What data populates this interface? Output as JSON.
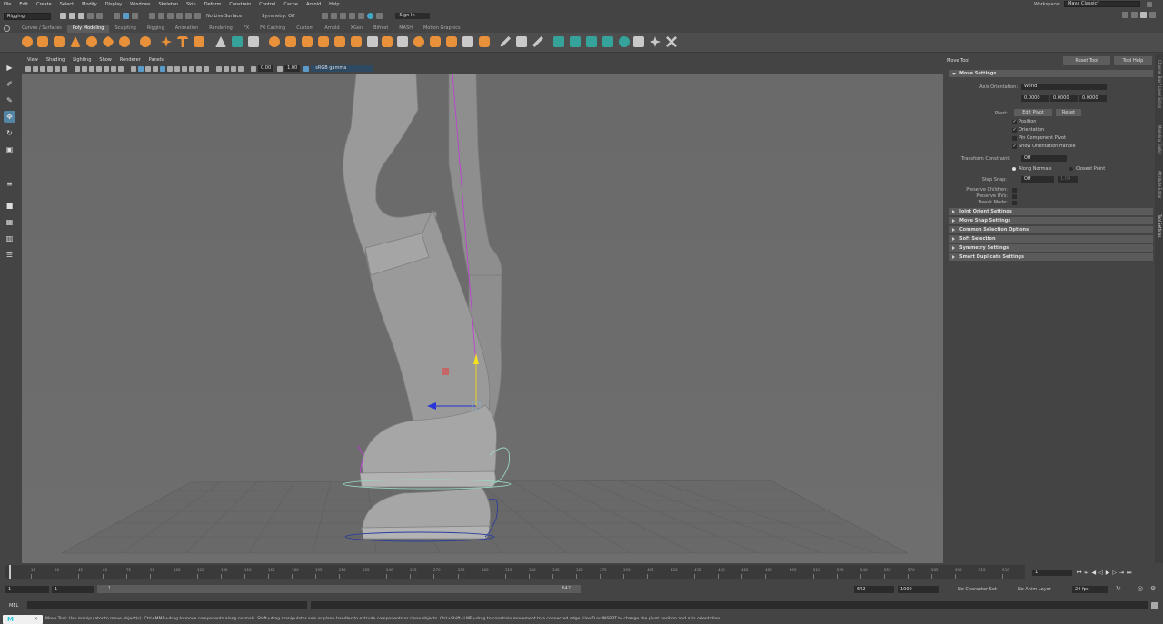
{
  "menu": [
    "File",
    "Edit",
    "Create",
    "Select",
    "Modify",
    "Display",
    "Windows",
    "Skeleton",
    "Skin",
    "Deform",
    "Constrain",
    "Control",
    "Cache",
    "Arnold",
    "Help"
  ],
  "workspace": {
    "label": "Workspace:",
    "value": "Maya Classic*"
  },
  "status": {
    "mode": "Rigging",
    "live_surface": "No Live Surface",
    "symmetry": "Symmetry: Off",
    "sign_in": "Sign In"
  },
  "shelf_tabs": [
    "Curves / Surfaces",
    "Poly Modeling",
    "Sculpting",
    "Rigging",
    "Animation",
    "Rendering",
    "FX",
    "FX Caching",
    "Custom",
    "Arnold",
    "XGen",
    "Bifrost",
    "MASH",
    "Motion Graphics"
  ],
  "active_shelf": "Poly Modeling",
  "viewport_menu": [
    "View",
    "Shading",
    "Lighting",
    "Show",
    "Renderer",
    "Panels"
  ],
  "viewport_toolbar": {
    "exposure": "0.00",
    "gamma": "1.00",
    "colorspace": "sRGB gamma"
  },
  "panel": {
    "title": "Move Tool",
    "reset_tool": "Reset Tool",
    "tool_help": "Tool Help",
    "move_settings": "Move Settings",
    "axis_orientation_label": "Axis Orientation:",
    "axis_orientation": "World",
    "axis_values": [
      "0.0000",
      "0.0000",
      "0.0000"
    ],
    "pivot_label": "Pivot:",
    "edit_pivot": "Edit Pivot",
    "reset": "Reset",
    "checks": [
      "Position",
      "Orientation",
      "Pin Component Pivot",
      "Show Orientation Handle"
    ],
    "transform_constraint_label": "Transform Constraint:",
    "transform_constraint": "Off",
    "along_normals": "Along Normals",
    "closest_point": "Closest Point",
    "step_snap_label": "Step Snap:",
    "step_snap": "Off",
    "step_snap_value": "1.00",
    "preserve_children": "Preserve Children:",
    "preserve_uvs": "Preserve UVs:",
    "tweak_mode": "Tweak Mode:",
    "sections": [
      "Joint Orient Settings",
      "Move Snap Settings",
      "Common Selection Options",
      "Soft Selection",
      "Symmetry Settings",
      "Smart Duplicate Settings"
    ]
  },
  "side_tabs": [
    "Channel Box / Layer Editor",
    "Modeling Toolkit",
    "Attribute Editor",
    "Tool Settings"
  ],
  "timeline": {
    "ticks": [
      "1",
      "15",
      "30",
      "45",
      "60",
      "75",
      "90",
      "105",
      "120",
      "135",
      "150",
      "165",
      "180",
      "195",
      "210",
      "225",
      "240",
      "255",
      "270",
      "285",
      "300",
      "315",
      "330",
      "345",
      "360",
      "375",
      "390",
      "405",
      "420",
      "435",
      "450",
      "465",
      "480",
      "495",
      "510",
      "525",
      "540",
      "555",
      "570",
      "585",
      "600",
      "615",
      "630"
    ],
    "current_frame": "1"
  },
  "range": {
    "start": "1",
    "playback_start": "1",
    "bar_start": "1",
    "bar_end": "642",
    "playback_end": "642",
    "end": "1000",
    "character_set": "No Character Set",
    "anim_layer": "No Anim Layer",
    "fps": "24 fps"
  },
  "command": {
    "language": "MEL"
  },
  "help_line": "Move Tool: Use manipulator to move object(s). Ctrl+MMB+drag to move components along normals. Shift+drag manipulator axis or plane handles to extrude components or clone objects. Ctrl+Shift+LMB+drag to constrain movement to a connected edge. Use D or INSERT to change the pivot position and axis orientation."
}
